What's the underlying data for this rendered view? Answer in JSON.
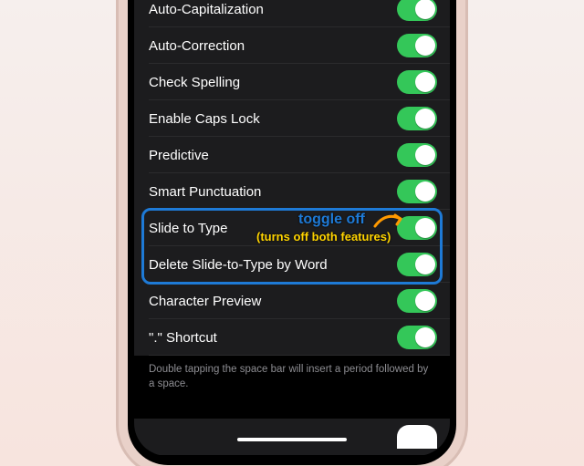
{
  "settings": {
    "rows": [
      {
        "label": "Auto-Capitalization",
        "on": true
      },
      {
        "label": "Auto-Correction",
        "on": true
      },
      {
        "label": "Check Spelling",
        "on": true
      },
      {
        "label": "Enable Caps Lock",
        "on": true
      },
      {
        "label": "Predictive",
        "on": true
      },
      {
        "label": "Smart Punctuation",
        "on": true
      },
      {
        "label": "Slide to Type",
        "on": true
      },
      {
        "label": "Delete Slide-to-Type by Word",
        "on": true
      },
      {
        "label": "Character Preview",
        "on": true
      },
      {
        "label": "\".\" Shortcut",
        "on": true
      }
    ],
    "footer": "Double tapping the space bar will insert a period followed by a space."
  },
  "annotation": {
    "toggle_off": "toggle off",
    "sub": "(turns off both features)"
  }
}
